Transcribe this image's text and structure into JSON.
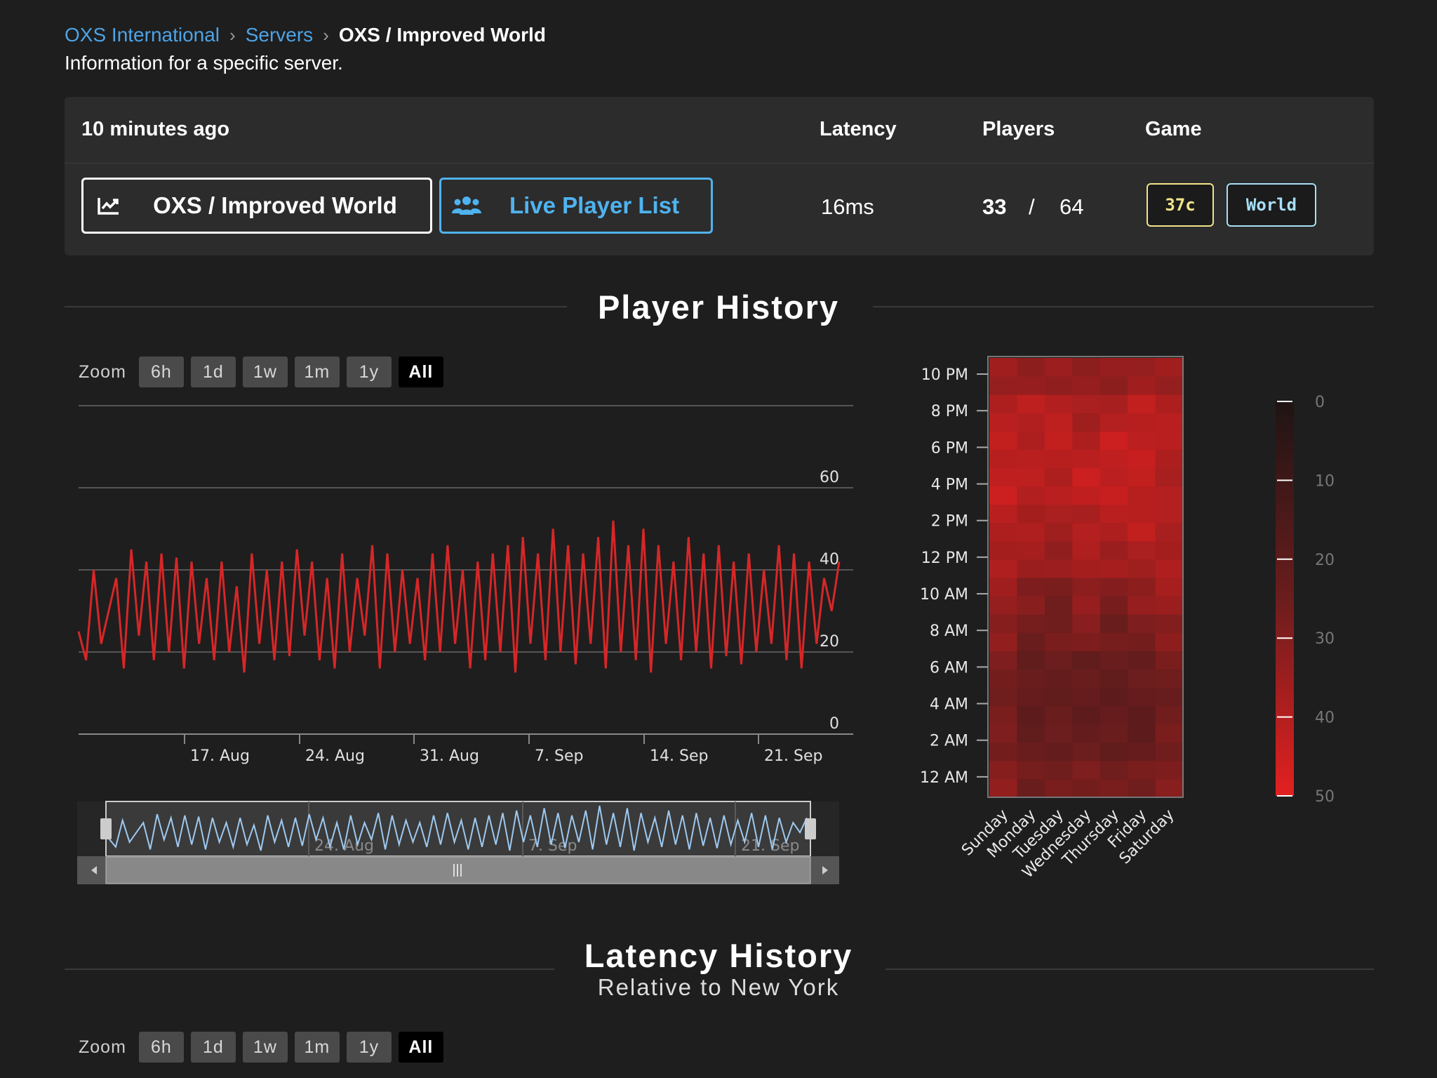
{
  "breadcrumb": {
    "items": [
      "OXS International",
      "Servers"
    ],
    "current": "OXS / Improved World",
    "separator": "›"
  },
  "subtitle": "Information for a specific server.",
  "info_card": {
    "last_seen": "10 minutes ago",
    "col_latency": "Latency",
    "col_players": "Players",
    "col_game": "Game",
    "server_button": {
      "label": "OXS / Improved World",
      "icon": "chart-line-icon"
    },
    "live_button": {
      "label": "Live Player List",
      "icon": "users-icon"
    },
    "latency": "16ms",
    "players_current": "33",
    "players_sep": "/",
    "players_max": "64",
    "tags": {
      "version": "37c",
      "game": "World"
    },
    "colors": {
      "version_tag": "#f2e38a",
      "game_tag": "#a7dff6",
      "live_button": "#4fb3ef"
    }
  },
  "player_history": {
    "title": "Player History",
    "zoom": {
      "label": "Zoom",
      "options": [
        "6h",
        "1d",
        "1w",
        "1m",
        "1y",
        "All"
      ],
      "selected": "All"
    }
  },
  "latency_history": {
    "title": "Latency History",
    "subtitle": "Relative to New York",
    "zoom": {
      "label": "Zoom",
      "options": [
        "6h",
        "1d",
        "1w",
        "1m",
        "1y",
        "All"
      ],
      "selected": "All"
    }
  },
  "chart_data": [
    {
      "type": "line",
      "ylim": [
        0,
        80
      ],
      "yticks": [
        0,
        20,
        40,
        60
      ],
      "xticks": [
        "17. Aug",
        "24. Aug",
        "31. Aug",
        "7. Sep",
        "14. Sep",
        "21. Sep"
      ],
      "x_range": [
        "2024-08-11",
        "2024-09-24"
      ],
      "series": [
        {
          "color": "#d62728",
          "values": [
            25,
            18,
            40,
            22,
            30,
            38,
            16,
            45,
            24,
            42,
            18,
            44,
            20,
            43,
            16,
            42,
            22,
            38,
            18,
            42,
            20,
            36,
            15,
            44,
            22,
            40,
            18,
            42,
            19,
            45,
            24,
            42,
            18,
            38,
            16,
            44,
            20,
            38,
            24,
            46,
            16,
            44,
            20,
            40,
            22,
            38,
            18,
            44,
            20,
            46,
            22,
            40,
            16,
            42,
            18,
            44,
            20,
            46,
            15,
            48,
            22,
            44,
            18,
            50,
            20,
            46,
            17,
            44,
            22,
            48,
            16,
            52,
            20,
            46,
            18,
            50,
            15,
            46,
            22,
            42,
            18,
            48,
            20,
            44,
            16,
            46,
            19,
            42,
            17,
            44,
            20,
            40,
            22,
            46,
            18,
            44,
            16,
            42,
            22,
            38,
            30,
            42
          ],
          "note": "approximate daily-cycle oscillation between ~10 and ~58 players"
        }
      ]
    },
    {
      "type": "heatmap",
      "x_categories": [
        "Sunday",
        "Monday",
        "Tuesday",
        "Wednesday",
        "Thursday",
        "Friday",
        "Saturday"
      ],
      "y_categories": [
        "12 AM",
        "2 AM",
        "4 AM",
        "6 AM",
        "8 AM",
        "10 AM",
        "12 PM",
        "2 PM",
        "4 PM",
        "6 PM",
        "8 PM",
        "10 PM"
      ],
      "colorbar": {
        "min": 0,
        "max": 50,
        "ticks": [
          0,
          10,
          20,
          30,
          40,
          50
        ]
      },
      "values": [
        [
          32,
          26,
          27,
          28,
          27,
          27,
          30
        ],
        [
          28,
          23,
          24,
          24,
          23,
          22,
          27
        ],
        [
          27,
          22,
          23,
          22,
          22,
          22,
          25
        ],
        [
          28,
          23,
          24,
          23,
          23,
          24,
          27
        ],
        [
          32,
          26,
          27,
          30,
          26,
          28,
          31
        ],
        [
          35,
          30,
          27,
          33,
          29,
          33,
          36
        ],
        [
          38,
          36,
          34,
          38,
          36,
          37,
          38
        ],
        [
          40,
          38,
          37,
          39,
          40,
          42,
          39
        ],
        [
          44,
          41,
          40,
          44,
          43,
          42,
          39
        ],
        [
          42,
          40,
          42,
          40,
          44,
          43,
          40
        ],
        [
          40,
          41,
          41,
          37,
          39,
          42,
          40
        ],
        [
          35,
          33,
          34,
          33,
          33,
          35,
          35
        ]
      ]
    }
  ]
}
